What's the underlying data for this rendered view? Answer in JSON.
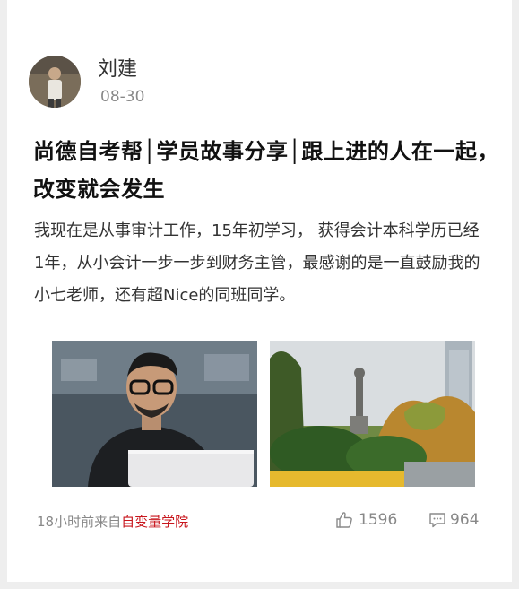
{
  "post": {
    "author": "刘建",
    "date": "08-30",
    "title": "尚德自考帮│学员故事分享│跟上进的人在一起，改变就会发生",
    "body": "我现在是从事审计工作，15年初学习， 获得会计本科学历已经1年，从小会计一步一步到财务主管，最感谢的是一直鼓励我的小七老师，还有超Nice的同班同学。",
    "images": [
      {
        "icon": "man-with-laptop-photo"
      },
      {
        "icon": "statue-park-photo"
      }
    ]
  },
  "footer": {
    "time_prefix": "18小时前来自",
    "source": "自变量学院",
    "likes": "1596",
    "comments": "964",
    "source_color": "#c8161d"
  }
}
